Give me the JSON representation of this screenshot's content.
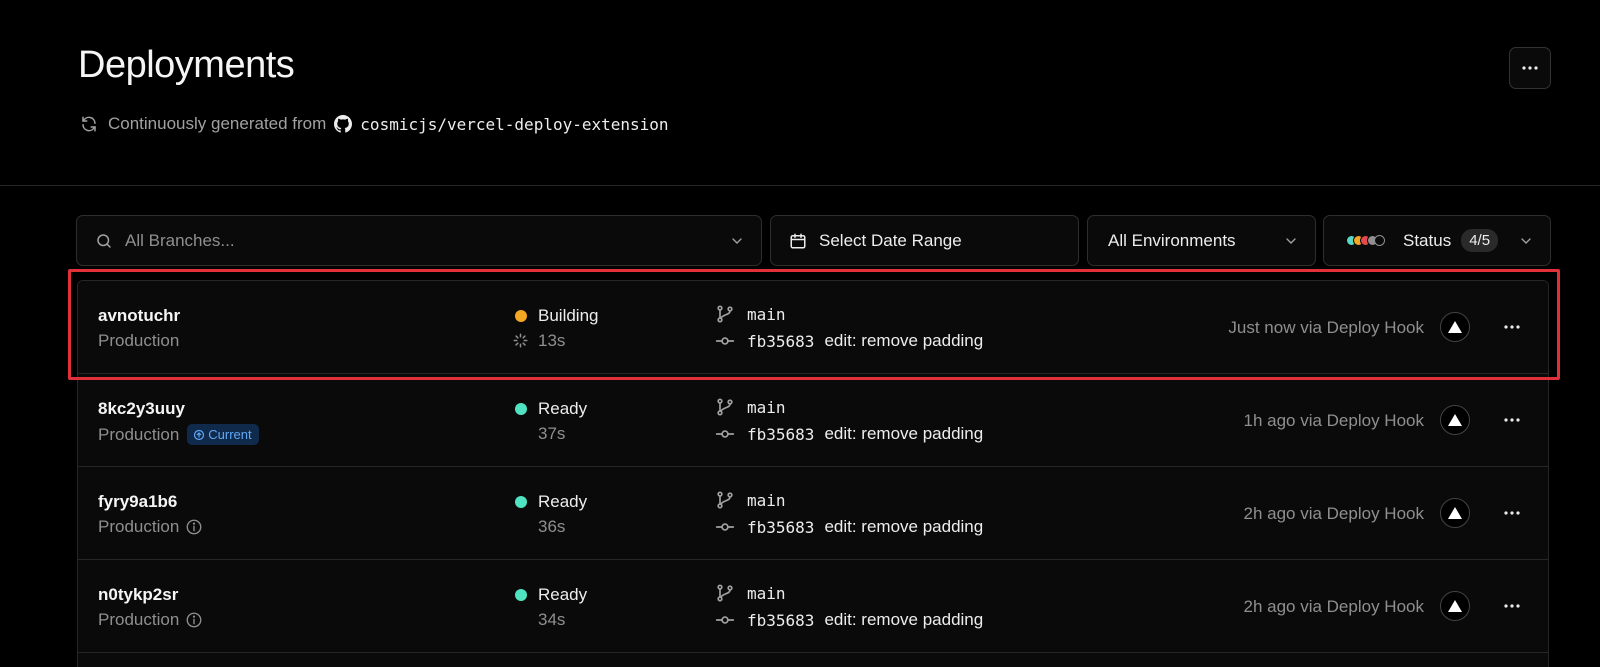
{
  "header": {
    "title": "Deployments",
    "subtitle_prefix": "Continuously generated from",
    "repo": "cosmicjs/vercel-deploy-extension"
  },
  "filters": {
    "branch_placeholder": "All Branches...",
    "date_label": "Select Date Range",
    "env_label": "All Environments",
    "status_label": "Status",
    "status_count": "4/5",
    "status_colors": [
      "#5ad8c3",
      "#f5a623",
      "#e5484d",
      "#8f8f8f"
    ]
  },
  "deployments": [
    {
      "id": "avnotuchr",
      "env": "Production",
      "status": "Building",
      "status_color": "#f5a623",
      "duration": "13s",
      "branch": "main",
      "sha": "fb35683",
      "message": "edit: remove padding",
      "time": "Just now via Deploy Hook"
    },
    {
      "id": "8kc2y3uuy",
      "env": "Production",
      "current_label": "Current",
      "status": "Ready",
      "status_color": "#50e3c2",
      "duration": "37s",
      "branch": "main",
      "sha": "fb35683",
      "message": "edit: remove padding",
      "time": "1h ago via Deploy Hook"
    },
    {
      "id": "fyry9a1b6",
      "env": "Production",
      "status": "Ready",
      "status_color": "#50e3c2",
      "duration": "36s",
      "branch": "main",
      "sha": "fb35683",
      "message": "edit: remove padding",
      "time": "2h ago via Deploy Hook"
    },
    {
      "id": "n0tykp2sr",
      "env": "Production",
      "status": "Ready",
      "status_color": "#50e3c2",
      "duration": "34s",
      "branch": "main",
      "sha": "fb35683",
      "message": "edit: remove padding",
      "time": "2h ago via Deploy Hook"
    }
  ],
  "colors": {
    "highlight": "#e0303a",
    "current_badge": "#62a6f5"
  }
}
